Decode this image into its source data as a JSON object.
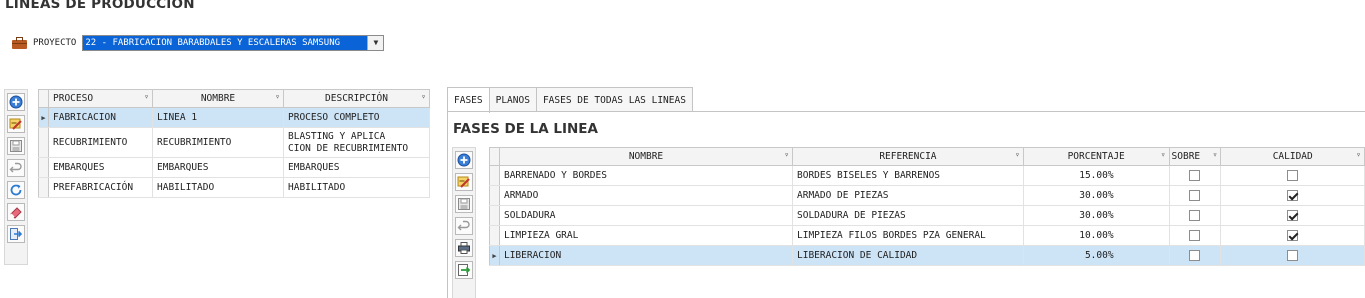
{
  "page": {
    "title": "LINEAS DE PRODUCCION"
  },
  "project": {
    "label": "PROYECTO",
    "value": "22 - FABRICACION BARABDALES Y ESCALERAS SAMSUNG",
    "icon": "briefcase-icon"
  },
  "left_toolbar": {
    "buttons": [
      "add-icon",
      "edit-icon",
      "save-icon",
      "undo-icon",
      "refresh-icon",
      "erase-icon",
      "export-icon"
    ]
  },
  "lines_table": {
    "columns": [
      "PROCESO",
      "NOMBRE",
      "DESCRIPCIÓN"
    ],
    "rows": [
      {
        "proceso": "FABRICACION",
        "nombre": "LINEA 1",
        "descripcion": "PROCESO COMPLETO",
        "selected": true
      },
      {
        "proceso": "RECUBRIMIENTO",
        "nombre": "RECUBRIMIENTO",
        "descripcion": "BLASTING Y APLICA\nCION DE RECUBRIMIENTO",
        "selected": false
      },
      {
        "proceso": "EMBARQUES",
        "nombre": "EMBARQUES",
        "descripcion": "EMBARQUES",
        "selected": false
      },
      {
        "proceso": "PREFABRICACIÓN",
        "nombre": "HABILITADO",
        "descripcion": "HABILITADO",
        "selected": false
      }
    ]
  },
  "tabs": [
    {
      "label": "FASES",
      "active": true
    },
    {
      "label": "PLANOS",
      "active": false
    },
    {
      "label": "FASES DE TODAS LAS LINEAS",
      "active": false
    }
  ],
  "phases": {
    "subtitle": "FASES DE LA LINEA",
    "toolbar": [
      "add-icon",
      "edit-icon",
      "save-icon",
      "undo-icon",
      "print-icon",
      "export-icon"
    ],
    "columns": [
      "NOMBRE",
      "REFERENCIA",
      "PORCENTAJE",
      "SOBRE",
      "CALIDAD"
    ],
    "rows": [
      {
        "nombre": "BARRENADO Y BORDES",
        "referencia": "BORDES BISELES Y BARRENOS",
        "porcentaje": "15.00%",
        "sobre": false,
        "calidad": false,
        "selected": false
      },
      {
        "nombre": "ARMADO",
        "referencia": "ARMADO DE PIEZAS",
        "porcentaje": "30.00%",
        "sobre": false,
        "calidad": true,
        "selected": false
      },
      {
        "nombre": "SOLDADURA",
        "referencia": "SOLDADURA DE PIEZAS",
        "porcentaje": "30.00%",
        "sobre": false,
        "calidad": true,
        "selected": false
      },
      {
        "nombre": "LIMPIEZA GRAL",
        "referencia": "LIMPIEZA FILOS BORDES PZA GENERAL",
        "porcentaje": "10.00%",
        "sobre": false,
        "calidad": true,
        "selected": false
      },
      {
        "nombre": "LIBERACION",
        "referencia": "LIBERACION DE CALIDAD",
        "porcentaje": "5.00%",
        "sobre": false,
        "calidad": false,
        "selected": true
      }
    ]
  }
}
